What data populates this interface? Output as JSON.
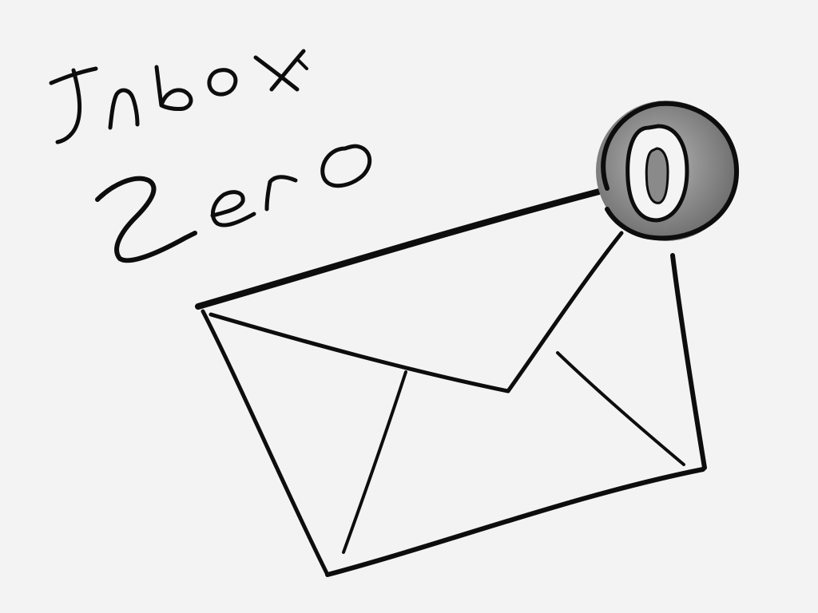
{
  "sketch": {
    "title_line_1": "Inbox",
    "title_line_2": "Zero",
    "badge_count": "0"
  },
  "colors": {
    "paper": "#f3f3f3",
    "ink": "#0d0d0d",
    "badge_fill": "#8e8e8e",
    "badge_digit_fill": "#f4f4f4"
  },
  "icons": {
    "envelope": "envelope-icon",
    "badge": "notification-badge-icon"
  }
}
